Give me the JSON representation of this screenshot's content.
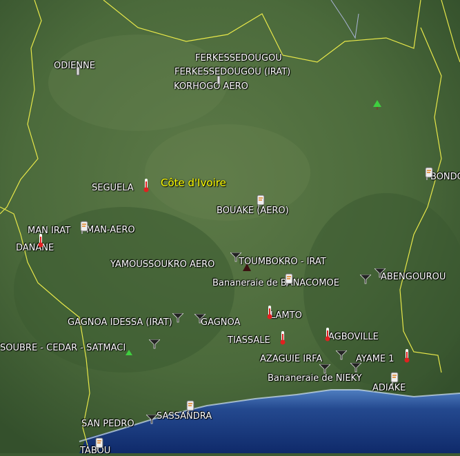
{
  "map": {
    "country_label": "Côte d'Ivoire",
    "stations": [
      {
        "label": "FERKESSEDOUGOU",
        "icon": "station-icon"
      },
      {
        "label": "FERKESSEDOUGOU (IRAT)",
        "icon": "station-icon"
      },
      {
        "label": "KORHOGO AERO",
        "icon": "station-icon"
      },
      {
        "label": "ODIENNE",
        "icon": "station-icon"
      },
      {
        "label": "SEGUELA",
        "icon": "thermometer-icon"
      },
      {
        "label": "BONDO",
        "icon": "weather-station-icon"
      },
      {
        "label": "BOUAKE (AERO)",
        "icon": "weather-station-icon"
      },
      {
        "label": "MAN IRAT",
        "icon": "thermometer-icon"
      },
      {
        "label": "MAN-AERO",
        "icon": "weather-station-icon"
      },
      {
        "label": "DANANE",
        "icon": "thermometer-icon"
      },
      {
        "label": "YAMOUSSOUKRO AERO",
        "icon": "funnel-icon"
      },
      {
        "label": "TOUMBOKRO - IRAT",
        "icon": "station-icon"
      },
      {
        "label": "Bananeraie de BANACOMOE",
        "icon": "weather-station-icon"
      },
      {
        "label": "ABENGOUROU",
        "icon": "funnel-icon"
      },
      {
        "label": "LAMTO",
        "icon": "thermometer-icon"
      },
      {
        "label": "GAGNOA IDESSA (IRAT)",
        "icon": "funnel-icon"
      },
      {
        "label": "GAGNOA",
        "icon": "funnel-icon"
      },
      {
        "label": "TIASSALE",
        "icon": "thermometer-icon"
      },
      {
        "label": "AGBOVILLE",
        "icon": "thermometer-icon"
      },
      {
        "label": "SOUBRE - CEDAR - SATMACI",
        "icon": "funnel-icon"
      },
      {
        "label": "AZAGUIE IRFA",
        "icon": "funnel-icon"
      },
      {
        "label": "AYAME 1",
        "icon": "thermometer-icon"
      },
      {
        "label": "Bananeraie de NIEKY",
        "icon": "funnel-icon"
      },
      {
        "label": "ADIAKE",
        "icon": "weather-station-icon"
      },
      {
        "label": "SAN PEDRO",
        "icon": "funnel-icon"
      },
      {
        "label": "SASSANDRA",
        "icon": "weather-station-icon"
      },
      {
        "label": "TABOU",
        "icon": "weather-station-icon"
      }
    ],
    "colors": {
      "border": "#e8e84a",
      "label": "#ffffff",
      "country_label": "#ffff00",
      "land": "#4a6a3a",
      "sea": "#1f3f80"
    }
  }
}
